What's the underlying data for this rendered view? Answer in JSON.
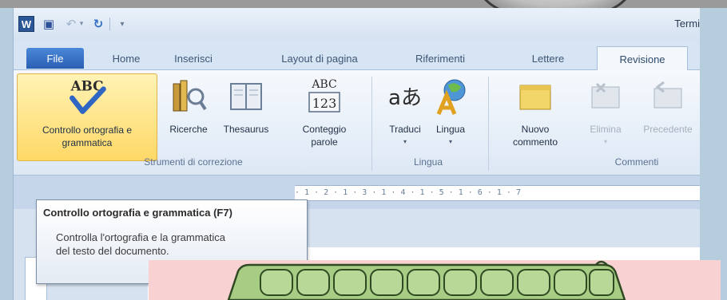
{
  "window": {
    "title": "Termi"
  },
  "qat": {
    "word_logo": "W"
  },
  "tabs": [
    "File",
    "Home",
    "Inserisci",
    "Layout di pagina",
    "Riferimenti",
    "Lettere",
    "Revisione"
  ],
  "ribbon": {
    "buttons": {
      "spell_icon_text": "ABC",
      "spell_label": "Controllo ortografia e grammatica",
      "ricerche": "Ricerche",
      "thesaurus": "Thesaurus",
      "conteggio_icon_top": "ABC",
      "conteggio_icon_bottom": "123",
      "conteggio": "Conteggio parole",
      "traduci_icon": "aあ",
      "traduci": "Traduci",
      "lingua": "Lingua",
      "nuovo": "Nuovo commento",
      "elimina": "Elimina",
      "precedente": "Precedente"
    },
    "groups": {
      "strumenti": "Strumenti di correzione",
      "lingua": "Lingua",
      "commenti": "Commenti"
    }
  },
  "ruler": {
    "text": "· 1 · 2 · 1 · 3 · 1 · 4 · 1 · 5 · 1 · 6 · 1 · 7"
  },
  "tooltip": {
    "title": "Controllo ortografia e grammatica (F7)",
    "body": "Controlla l'ortografia e la grammatica del testo del documento."
  },
  "colors": {
    "file_tab": "#2a5fb3",
    "spell_highlight": "#ffd866",
    "keyboard_keys": "#a7cc84",
    "keyboard_panel": "#f8d2d2"
  }
}
